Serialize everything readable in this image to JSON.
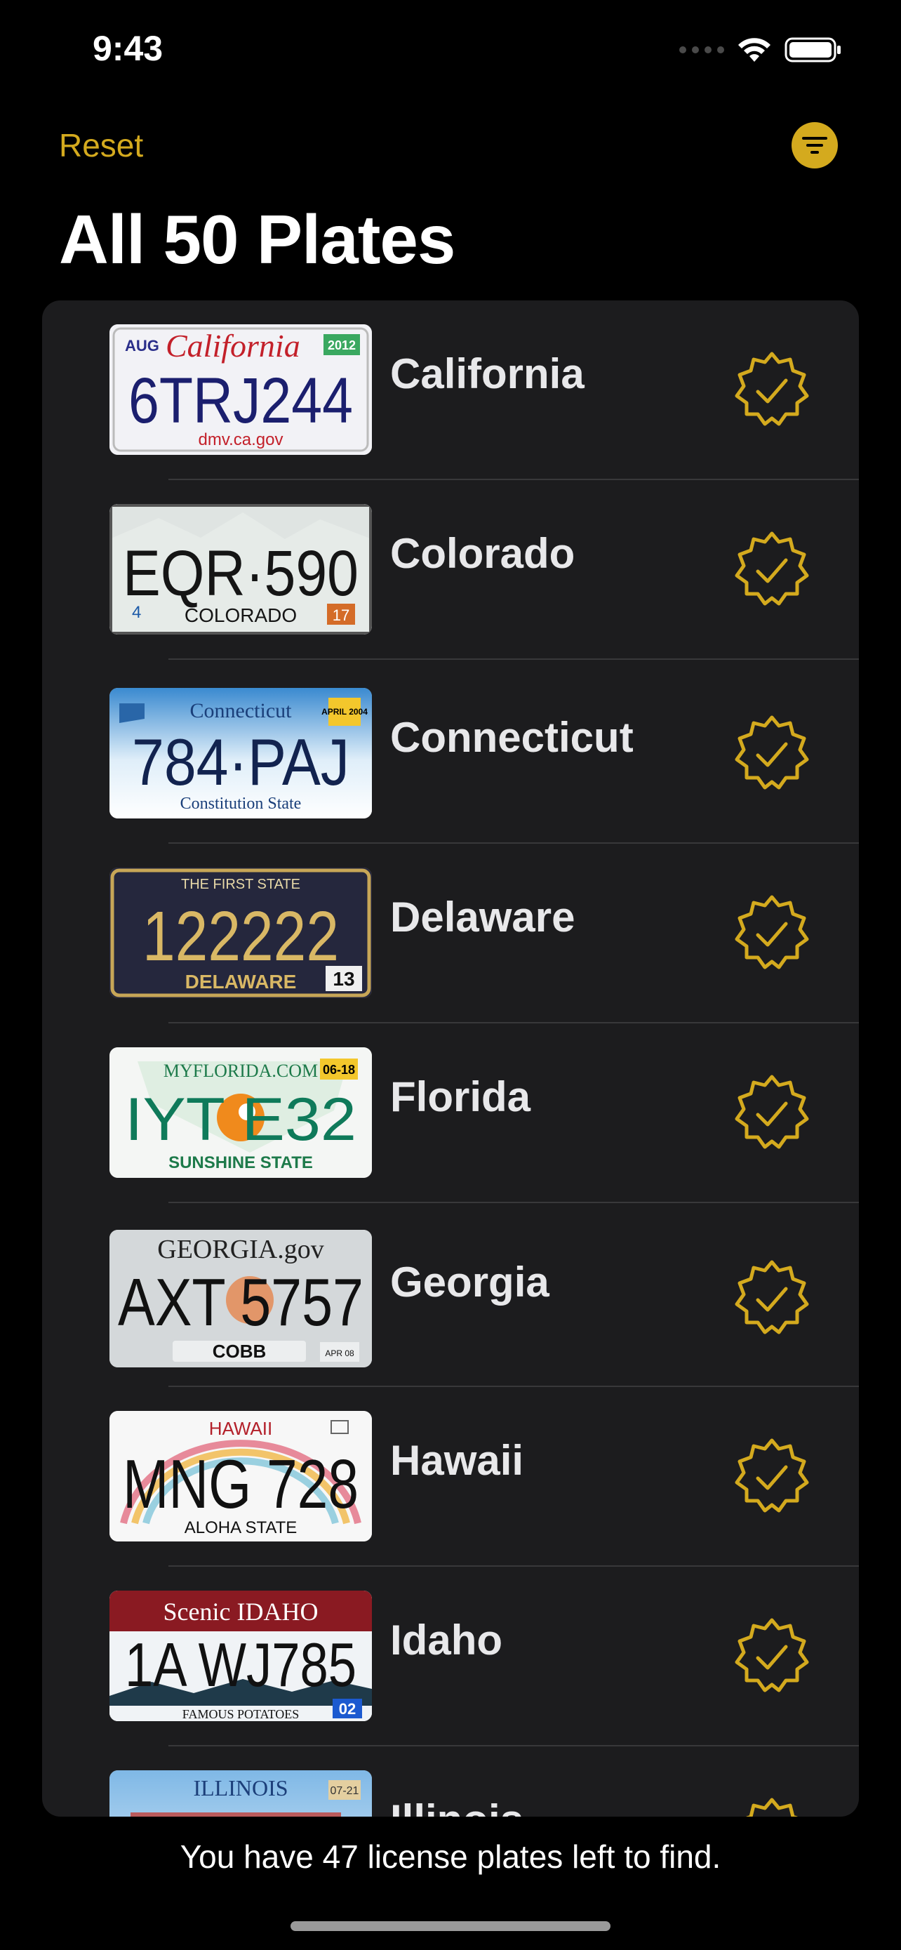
{
  "status_bar": {
    "time": "9:43"
  },
  "nav": {
    "reset_label": "Reset",
    "filter_icon": "filter-circle-icon",
    "accent_color": "#d4aa1e"
  },
  "title": "All 50 Plates",
  "plates": [
    {
      "state": "California",
      "plate_text": "6TRJ244",
      "top_text": "California",
      "bottom_text": "dmv.ca.gov",
      "corner_tag": "AUG",
      "sticker": "2012",
      "checked": true
    },
    {
      "state": "Colorado",
      "plate_text": "EQR·590",
      "top_text": "",
      "bottom_text": "COLORADO",
      "corner_tag": "4",
      "sticker": "17",
      "checked": true
    },
    {
      "state": "Connecticut",
      "plate_text": "784·PAJ",
      "top_text": "Connecticut",
      "bottom_text": "Constitution State",
      "corner_tag": "",
      "sticker": "APRIL 2004",
      "checked": true
    },
    {
      "state": "Delaware",
      "plate_text": "122222",
      "top_text": "THE FIRST STATE",
      "bottom_text": "DELAWARE",
      "corner_tag": "",
      "sticker": "13",
      "checked": true
    },
    {
      "state": "Florida",
      "plate_text": "IYT E32",
      "top_text": "MYFLORIDA.COM",
      "bottom_text": "SUNSHINE STATE",
      "corner_tag": "",
      "sticker": "06-18",
      "checked": true
    },
    {
      "state": "Georgia",
      "plate_text": "AXT 5757",
      "top_text": "GEORGIA.gov",
      "bottom_text": "COBB",
      "corner_tag": "",
      "sticker": "APR 08",
      "checked": true
    },
    {
      "state": "Hawaii",
      "plate_text": "MNG 728",
      "top_text": "HAWAII",
      "bottom_text": "ALOHA STATE",
      "corner_tag": "",
      "sticker": "",
      "checked": true
    },
    {
      "state": "Idaho",
      "plate_text": "1A WJ785",
      "top_text": "Scenic IDAHO",
      "bottom_text": "FAMOUS POTATOES",
      "corner_tag": "",
      "sticker": "02",
      "checked": true
    },
    {
      "state": "Illinois",
      "plate_text": "",
      "top_text": "ILLINOIS",
      "bottom_text": "",
      "corner_tag": "",
      "sticker": "07-21",
      "checked": true
    }
  ],
  "footer": {
    "message": "You have 47 license plates left to find."
  }
}
